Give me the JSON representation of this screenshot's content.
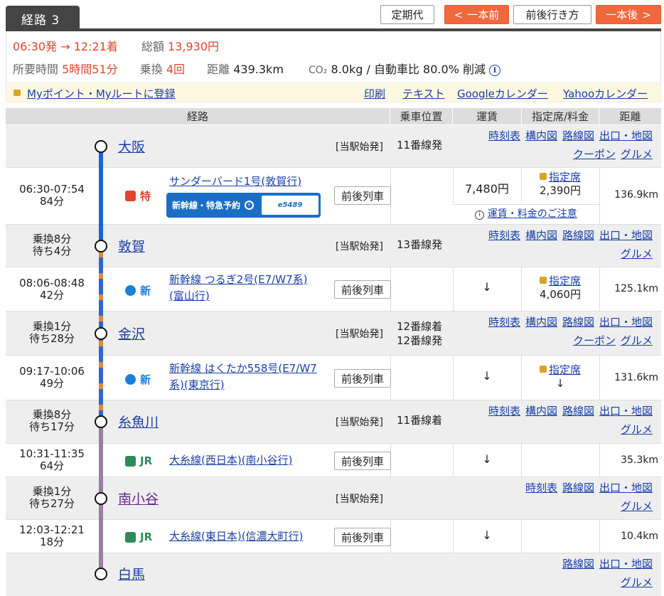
{
  "tab": {
    "label": "経路 3"
  },
  "toolbar": {
    "commuter": "定期代",
    "prev": "一本前",
    "around": "前後行き方",
    "next": "一本後"
  },
  "summary": {
    "depart": "06:30発",
    "arrow": "→",
    "arrive": "12:21着",
    "total_label": "総額",
    "total": "13,930円",
    "duration_label": "所要時間",
    "duration": "5時間51分",
    "transfers_label": "乗換",
    "transfers": "4回",
    "distance_label": "距離",
    "distance": "439.3km",
    "co2_label": "CO₂",
    "co2": "8.0kg / 自動車比 80.0% 削減"
  },
  "links": {
    "register": "Myポイント・Myルートに登録",
    "print": "印刷",
    "text": "テキスト",
    "google": "Googleカレンダー",
    "yahoo": "Yahooカレンダー"
  },
  "headers": {
    "route": "経路",
    "position": "乗車位置",
    "fare": "運賃",
    "reserved": "指定席/料金",
    "distance": "距離"
  },
  "stations": [
    {
      "name": "大阪",
      "note": "[当駅始発]",
      "platform": "11番線発",
      "links1": [
        "時刻表",
        "構内図",
        "路線図",
        "出口・地図"
      ],
      "links2": [
        "クーポン",
        "グルメ"
      ]
    },
    {
      "name": "敦賀",
      "transfer": "乗換8分",
      "wait": "待ち4分",
      "note": "[当駅始発]",
      "platform": "13番線発",
      "links1": [
        "時刻表",
        "構内図",
        "路線図",
        "出口・地図"
      ],
      "links2": [
        "グルメ"
      ]
    },
    {
      "name": "金沢",
      "transfer": "乗換1分",
      "wait": "待ち28分",
      "note": "[当駅始発]",
      "platform": "12番線着",
      "platform2": "12番線発",
      "links1": [
        "時刻表",
        "構内図",
        "路線図",
        "出口・地図"
      ],
      "links2": [
        "クーポン",
        "グルメ"
      ]
    },
    {
      "name": "糸魚川",
      "transfer": "乗換8分",
      "wait": "待ち17分",
      "note": "[当駅始発]",
      "platform": "11番線着",
      "links1": [
        "時刻表",
        "構内図",
        "路線図",
        "出口・地図"
      ],
      "links2": [
        "グルメ"
      ]
    },
    {
      "name": "南小谷",
      "transfer": "乗換1分",
      "wait": "待ち27分",
      "note": "[当駅始発]",
      "links1": [
        "時刻表",
        "路線図",
        "出口・地図"
      ],
      "links2": [
        "グルメ"
      ]
    },
    {
      "name": "白馬",
      "links1": [
        "路線図",
        "出口・地図"
      ],
      "links2": [
        "グルメ"
      ]
    }
  ],
  "trains": [
    {
      "time": "06:30-07:54",
      "mins": "84分",
      "badge": "特",
      "name1": "サンダーバード1号(敦賀行)",
      "name2": "",
      "ebanner": "新幹線・特急予約",
      "ebanner_sub": "e5489",
      "button": "前後列車",
      "fare": "7,480円",
      "resv": "指定席",
      "resv_fee": "2,390円",
      "dist": "136.9km",
      "notice": "運賃・料金のご注意"
    },
    {
      "time": "08:06-08:48",
      "mins": "42分",
      "badge": "新",
      "name1": "新幹線 つるぎ2号(E7/W7系)",
      "name2": "(富山行)",
      "button": "前後列車",
      "fare": "↓",
      "resv": "指定席",
      "resv_fee": "4,060円",
      "dist": "125.1km"
    },
    {
      "time": "09:17-10:06",
      "mins": "49分",
      "badge": "新",
      "name1": "新幹線 はくたか558号(E7/W7",
      "name2": "系)(東京行)",
      "button": "前後列車",
      "fare": "↓",
      "resv": "指定席",
      "resv_fee": "↓",
      "dist": "131.6km"
    },
    {
      "time": "10:31-11:35",
      "mins": "64分",
      "badge": "JR",
      "name1": "大糸線(西日本)(南小谷行)",
      "name2": "",
      "button": "前後列車",
      "fare": "↓",
      "resv": "",
      "resv_fee": "",
      "dist": "35.3km"
    },
    {
      "time": "12:03-12:21",
      "mins": "18分",
      "badge": "JR",
      "name1": "大糸線(東日本)(信濃大町行)",
      "name2": "",
      "button": "前後列車",
      "fare": "↓",
      "resv": "",
      "resv_fee": "",
      "dist": "10.4km"
    }
  ],
  "colors": {
    "accent": "#f0683c",
    "shinkansen_line": "#3366cc",
    "limited_line": "#1b63d6",
    "jr_line": "#9a7fa1",
    "jr_green": "#2e8b57",
    "lock": "#d9a420"
  }
}
